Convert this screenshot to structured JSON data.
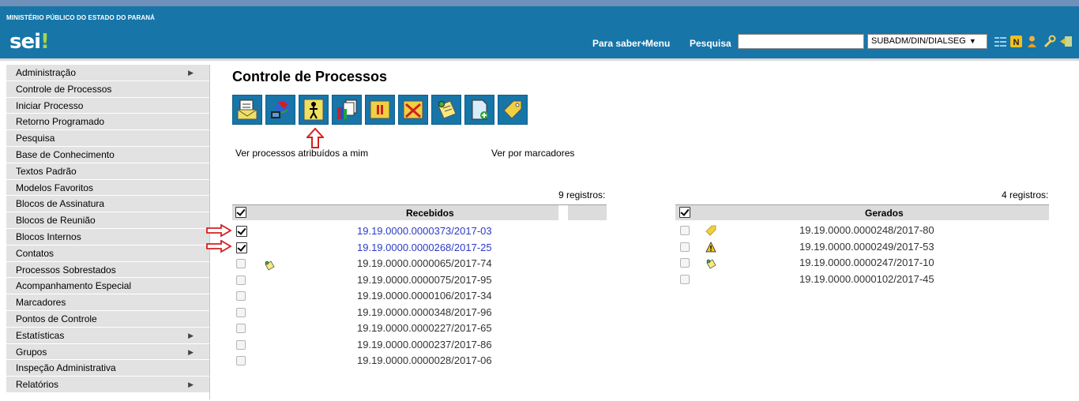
{
  "header": {
    "org_name": "MINISTÉRIO PÚBLICO DO ESTADO DO PARANÁ",
    "logo_text": "sei",
    "logo_mark": "!",
    "links": {
      "para_saber": "Para saber+",
      "menu": "Menu",
      "pesquisa": "Pesquisa"
    },
    "search_value": "",
    "unit_select": "SUBADM/DIN/DIALSEG",
    "icons": [
      "list-icon",
      "notepad-icon",
      "user-icon",
      "wrench-icon",
      "exit-icon"
    ]
  },
  "sidebar": {
    "items": [
      {
        "label": "Administração",
        "submenu": "▶"
      },
      {
        "label": "Controle de Processos"
      },
      {
        "label": "Iniciar Processo"
      },
      {
        "label": "Retorno Programado"
      },
      {
        "label": "Pesquisa"
      },
      {
        "label": "Base de Conhecimento"
      },
      {
        "label": "Textos Padrão"
      },
      {
        "label": "Modelos Favoritos"
      },
      {
        "label": "Blocos de Assinatura"
      },
      {
        "label": "Blocos de Reunião"
      },
      {
        "label": "Blocos Internos"
      },
      {
        "label": "Contatos"
      },
      {
        "label": "Processos Sobrestados"
      },
      {
        "label": "Acompanhamento Especial"
      },
      {
        "label": "Marcadores"
      },
      {
        "label": "Pontos de Controle"
      },
      {
        "label": "Estatísticas",
        "submenu": "▶"
      },
      {
        "label": "Grupos",
        "submenu": "▶"
      },
      {
        "label": "Inspeção Administrativa"
      },
      {
        "label": "Relatórios",
        "submenu": "▶"
      }
    ]
  },
  "main": {
    "title": "Controle de Processos",
    "toolbar": [
      "send-process-icon",
      "update-andamento-icon",
      "assign-process-icon",
      "docs-icon",
      "sobrestar-icon",
      "conclude-icon",
      "annotation-icon",
      "new-document-icon",
      "marker-icon"
    ],
    "link_assigned": "Ver processos atribuídos a mim",
    "link_markers": "Ver por marcadores",
    "colors": {
      "link": "#2b3bc7",
      "header_blue": "#1775a8",
      "arrow_red": "#d42020"
    }
  },
  "recebidos": {
    "count": "9 registros:",
    "title": "Recebidos",
    "rows": [
      {
        "number": "19.19.0000.0000373/2017-03",
        "checked": true,
        "icon": ""
      },
      {
        "number": "19.19.0000.0000268/2017-25",
        "checked": true,
        "icon": ""
      },
      {
        "number": "19.19.0000.0000065/2017-74",
        "checked": false,
        "icon": "annotation-icon"
      },
      {
        "number": "19.19.0000.0000075/2017-95",
        "checked": false,
        "icon": ""
      },
      {
        "number": "19.19.0000.0000106/2017-34",
        "checked": false,
        "icon": ""
      },
      {
        "number": "19.19.0000.0000348/2017-96",
        "checked": false,
        "icon": ""
      },
      {
        "number": "19.19.0000.0000227/2017-65",
        "checked": false,
        "icon": ""
      },
      {
        "number": "19.19.0000.0000237/2017-86",
        "checked": false,
        "icon": ""
      },
      {
        "number": "19.19.0000.0000028/2017-06",
        "checked": false,
        "icon": ""
      }
    ]
  },
  "gerados": {
    "count": "4 registros:",
    "title": "Gerados",
    "rows": [
      {
        "number": "19.19.0000.0000248/2017-80",
        "checked": false,
        "icon": "marker-icon"
      },
      {
        "number": "19.19.0000.0000249/2017-53",
        "checked": false,
        "icon": "warning-icon"
      },
      {
        "number": "19.19.0000.0000247/2017-10",
        "checked": false,
        "icon": "annotation-icon"
      },
      {
        "number": "19.19.0000.0000102/2017-45",
        "checked": false,
        "icon": ""
      }
    ]
  }
}
